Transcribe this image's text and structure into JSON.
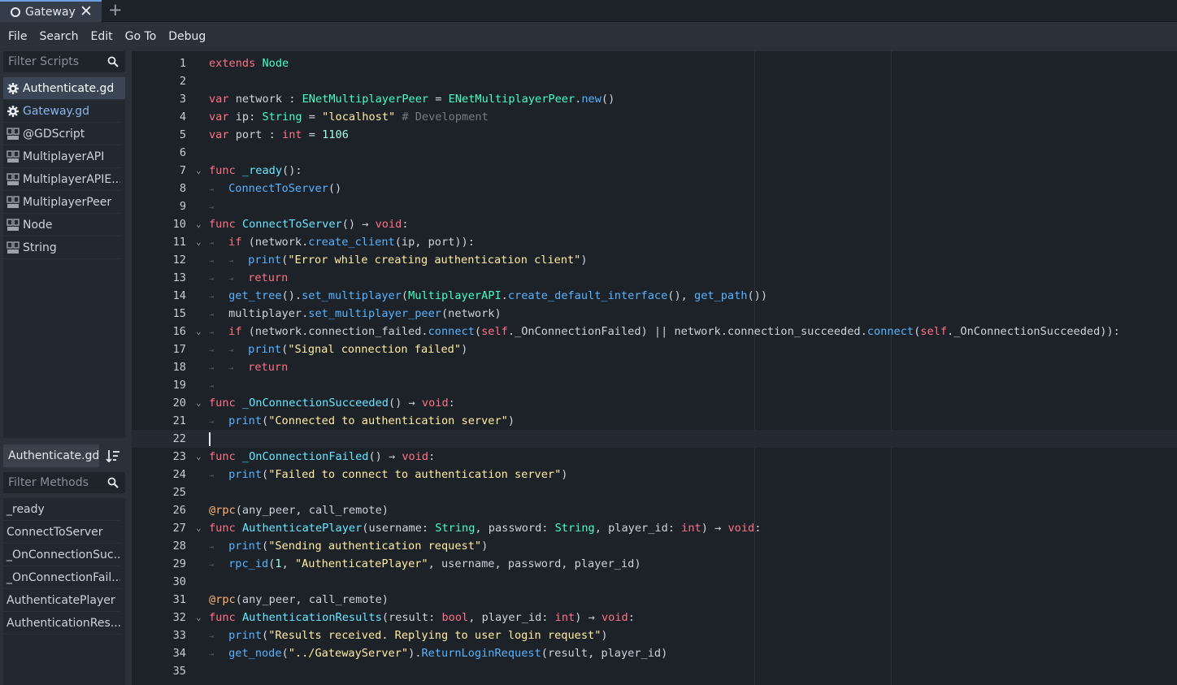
{
  "tab": {
    "title": "Gateway",
    "close_glyph": "✕",
    "new_glyph": "+"
  },
  "menu": [
    "File",
    "Search",
    "Edit",
    "Go To",
    "Debug"
  ],
  "script_filter": {
    "placeholder": "Filter Scripts"
  },
  "scripts": [
    {
      "label": "Authenticate.gd",
      "icon": "gear-icon",
      "state": "selected"
    },
    {
      "label": "Gateway.gd",
      "icon": "gear-icon",
      "state": "open"
    },
    {
      "label": "@GDScript",
      "icon": "doc-icon",
      "state": ""
    },
    {
      "label": "MultiplayerAPI",
      "icon": "doc-icon",
      "state": ""
    },
    {
      "label": "MultiplayerAPIE...",
      "icon": "doc-icon",
      "state": ""
    },
    {
      "label": "MultiplayerPeer",
      "icon": "doc-icon",
      "state": ""
    },
    {
      "label": "Node",
      "icon": "doc-icon",
      "state": ""
    },
    {
      "label": "String",
      "icon": "doc-icon",
      "state": ""
    }
  ],
  "current_file": "Authenticate.gd",
  "method_filter": {
    "placeholder": "Filter Methods"
  },
  "methods": [
    "_ready",
    "ConnectToServer",
    "_OnConnectionSuc...",
    "_OnConnectionFail...",
    "AuthenticatePlayer",
    "AuthenticationRes..."
  ],
  "colors": {
    "keyword": "#ff7085",
    "type": "#42ffc2",
    "function": "#57b3ff",
    "string": "#ffeda1",
    "number": "#a1ffe0",
    "comment": "#767b84",
    "annotation": "#ffb373",
    "selection": "#3a4656",
    "open_script": "#8bb4ec"
  },
  "editor": {
    "current_line": 22,
    "lines": [
      {
        "n": "1",
        "fold": false,
        "tokens": [
          [
            "kw",
            "extends"
          ],
          [
            "",
            "␠"
          ],
          [
            "ty",
            "Node"
          ]
        ]
      },
      {
        "n": "2",
        "fold": false,
        "tokens": []
      },
      {
        "n": "3",
        "fold": false,
        "tokens": [
          [
            "kw",
            "var"
          ],
          [
            "",
            "␠network␠:␠"
          ],
          [
            "ty",
            "ENetMultiplayerPeer"
          ],
          [
            "",
            "␠=␠"
          ],
          [
            "ty",
            "ENetMultiplayerPeer"
          ],
          [
            "",
            "."
          ],
          [
            "fn",
            "new"
          ],
          [
            "",
            "()"
          ]
        ]
      },
      {
        "n": "4",
        "fold": false,
        "tokens": [
          [
            "kw",
            "var"
          ],
          [
            "",
            "␠ip:␠"
          ],
          [
            "ty",
            "String"
          ],
          [
            "",
            "␠=␠"
          ],
          [
            "st",
            "\"localhost\""
          ],
          [
            "",
            "␠"
          ],
          [
            "cm",
            "#␠Development"
          ]
        ]
      },
      {
        "n": "5",
        "fold": false,
        "tokens": [
          [
            "kw",
            "var"
          ],
          [
            "",
            "␠port␠:␠"
          ],
          [
            "kw",
            "int"
          ],
          [
            "",
            "␠=␠"
          ],
          [
            "nm",
            "1106"
          ]
        ]
      },
      {
        "n": "6",
        "fold": false,
        "tokens": []
      },
      {
        "n": "7",
        "fold": true,
        "tokens": [
          [
            "kw",
            "func"
          ],
          [
            "",
            "␠"
          ],
          [
            "fd",
            "_ready"
          ],
          [
            "",
            "():"
          ]
        ]
      },
      {
        "n": "8",
        "fold": false,
        "tokens": [
          [
            "tab",
            "⇥"
          ],
          [
            "fn",
            "ConnectToServer"
          ],
          [
            "",
            "()"
          ]
        ]
      },
      {
        "n": "9",
        "fold": false,
        "tokens": [
          [
            "tab",
            "⇥"
          ]
        ]
      },
      {
        "n": "10",
        "fold": true,
        "tokens": [
          [
            "kw",
            "func"
          ],
          [
            "",
            "␠"
          ],
          [
            "fd",
            "ConnectToServer"
          ],
          [
            "",
            "()␠→␠"
          ],
          [
            "kw",
            "void"
          ],
          [
            "",
            ":"
          ]
        ]
      },
      {
        "n": "11",
        "fold": true,
        "tokens": [
          [
            "tab",
            "⇥"
          ],
          [
            "kw",
            "if"
          ],
          [
            "",
            "␠(network."
          ],
          [
            "fn",
            "create_client"
          ],
          [
            "",
            "(ip,␠port)):"
          ]
        ]
      },
      {
        "n": "12",
        "fold": false,
        "tokens": [
          [
            "tab",
            "⇥"
          ],
          [
            "tab",
            "⇥"
          ],
          [
            "fn",
            "print"
          ],
          [
            "",
            "("
          ],
          [
            "st",
            "\"Error␠while␠creating␠authentication␠client\""
          ],
          [
            "",
            ")"
          ]
        ]
      },
      {
        "n": "13",
        "fold": false,
        "tokens": [
          [
            "tab",
            "⇥"
          ],
          [
            "tab",
            "⇥"
          ],
          [
            "kw",
            "return"
          ]
        ]
      },
      {
        "n": "14",
        "fold": false,
        "tokens": [
          [
            "tab",
            "⇥"
          ],
          [
            "fn",
            "get_tree"
          ],
          [
            "",
            "()."
          ],
          [
            "fn",
            "set_multiplayer"
          ],
          [
            "",
            "("
          ],
          [
            "ty",
            "MultiplayerAPI"
          ],
          [
            "",
            "."
          ],
          [
            "fn",
            "create_default_interface"
          ],
          [
            "",
            "(),␠"
          ],
          [
            "fn",
            "get_path"
          ],
          [
            "",
            "())"
          ]
        ]
      },
      {
        "n": "15",
        "fold": false,
        "tokens": [
          [
            "tab",
            "⇥"
          ],
          [
            "",
            "multiplayer."
          ],
          [
            "fn",
            "set_multiplayer_peer"
          ],
          [
            "",
            "(network)"
          ]
        ]
      },
      {
        "n": "16",
        "fold": true,
        "tokens": [
          [
            "tab",
            "⇥"
          ],
          [
            "kw",
            "if"
          ],
          [
            "",
            "␠(network.connection_failed."
          ],
          [
            "fn",
            "connect"
          ],
          [
            "",
            "("
          ],
          [
            "kw",
            "self"
          ],
          [
            "",
            "._OnConnectionFailed)␠||␠network.connection_succeeded."
          ],
          [
            "fn",
            "connect"
          ],
          [
            "",
            "("
          ],
          [
            "kw",
            "self"
          ],
          [
            "",
            "._OnConnectionSucceeded)):"
          ]
        ]
      },
      {
        "n": "17",
        "fold": false,
        "tokens": [
          [
            "tab",
            "⇥"
          ],
          [
            "tab",
            "⇥"
          ],
          [
            "fn",
            "print"
          ],
          [
            "",
            "("
          ],
          [
            "st",
            "\"Signal␠connection␠failed\""
          ],
          [
            "",
            ")"
          ]
        ]
      },
      {
        "n": "18",
        "fold": false,
        "tokens": [
          [
            "tab",
            "⇥"
          ],
          [
            "tab",
            "⇥"
          ],
          [
            "kw",
            "return"
          ]
        ]
      },
      {
        "n": "19",
        "fold": false,
        "tokens": [
          [
            "tab",
            "⇥"
          ]
        ]
      },
      {
        "n": "20",
        "fold": true,
        "tokens": [
          [
            "kw",
            "func"
          ],
          [
            "",
            "␠"
          ],
          [
            "fd",
            "_OnConnectionSucceeded"
          ],
          [
            "",
            "()␠→␠"
          ],
          [
            "kw",
            "void"
          ],
          [
            "",
            ":"
          ]
        ]
      },
      {
        "n": "21",
        "fold": false,
        "tokens": [
          [
            "tab",
            "⇥"
          ],
          [
            "fn",
            "print"
          ],
          [
            "",
            "("
          ],
          [
            "st",
            "\"Connected␠to␠authentication␠server\""
          ],
          [
            "",
            ")"
          ]
        ]
      },
      {
        "n": "22",
        "fold": false,
        "tokens": []
      },
      {
        "n": "23",
        "fold": true,
        "tokens": [
          [
            "kw",
            "func"
          ],
          [
            "",
            "␠"
          ],
          [
            "fd",
            "_OnConnectionFailed"
          ],
          [
            "",
            "()␠→␠"
          ],
          [
            "kw",
            "void"
          ],
          [
            "",
            ":"
          ]
        ]
      },
      {
        "n": "24",
        "fold": false,
        "tokens": [
          [
            "tab",
            "⇥"
          ],
          [
            "fn",
            "print"
          ],
          [
            "",
            "("
          ],
          [
            "st",
            "\"Failed␠to␠connect␠to␠authentication␠server\""
          ],
          [
            "",
            ")"
          ]
        ]
      },
      {
        "n": "25",
        "fold": false,
        "tokens": []
      },
      {
        "n": "26",
        "fold": false,
        "tokens": [
          [
            "an",
            "@rpc"
          ],
          [
            "",
            "(any_peer,␠call_remote)"
          ]
        ]
      },
      {
        "n": "27",
        "fold": true,
        "tokens": [
          [
            "kw",
            "func"
          ],
          [
            "",
            "␠"
          ],
          [
            "fd",
            "AuthenticatePlayer"
          ],
          [
            "",
            "(username:␠"
          ],
          [
            "ty",
            "String"
          ],
          [
            "",
            ",␠password:␠"
          ],
          [
            "ty",
            "String"
          ],
          [
            "",
            ",␠player_id:␠"
          ],
          [
            "kw",
            "int"
          ],
          [
            "",
            ")␠→␠"
          ],
          [
            "kw",
            "void"
          ],
          [
            "",
            ":"
          ]
        ]
      },
      {
        "n": "28",
        "fold": false,
        "tokens": [
          [
            "tab",
            "⇥"
          ],
          [
            "fn",
            "print"
          ],
          [
            "",
            "("
          ],
          [
            "st",
            "\"Sending␠authentication␠request\""
          ],
          [
            "",
            ")"
          ]
        ]
      },
      {
        "n": "29",
        "fold": false,
        "tokens": [
          [
            "tab",
            "⇥"
          ],
          [
            "fn",
            "rpc_id"
          ],
          [
            "",
            "("
          ],
          [
            "nm",
            "1"
          ],
          [
            "",
            ",␠"
          ],
          [
            "st",
            "\"AuthenticatePlayer\""
          ],
          [
            "",
            ",␠username,␠password,␠player_id)"
          ]
        ]
      },
      {
        "n": "30",
        "fold": false,
        "tokens": []
      },
      {
        "n": "31",
        "fold": false,
        "tokens": [
          [
            "an",
            "@rpc"
          ],
          [
            "",
            "(any_peer,␠call_remote)"
          ]
        ]
      },
      {
        "n": "32",
        "fold": true,
        "tokens": [
          [
            "kw",
            "func"
          ],
          [
            "",
            "␠"
          ],
          [
            "fd",
            "AuthenticationResults"
          ],
          [
            "",
            "(result:␠"
          ],
          [
            "kw",
            "bool"
          ],
          [
            "",
            ",␠player_id:␠"
          ],
          [
            "kw",
            "int"
          ],
          [
            "",
            ")␠→␠"
          ],
          [
            "kw",
            "void"
          ],
          [
            "",
            ":"
          ]
        ]
      },
      {
        "n": "33",
        "fold": false,
        "tokens": [
          [
            "tab",
            "⇥"
          ],
          [
            "fn",
            "print"
          ],
          [
            "",
            "("
          ],
          [
            "st",
            "\"Results␠received.␠Replying␠to␠user␠login␠request\""
          ],
          [
            "",
            ")"
          ]
        ]
      },
      {
        "n": "34",
        "fold": false,
        "tokens": [
          [
            "tab",
            "⇥"
          ],
          [
            "fn",
            "get_node"
          ],
          [
            "",
            "("
          ],
          [
            "st",
            "\"../GatewayServer\""
          ],
          [
            "",
            ")."
          ],
          [
            "fn",
            "ReturnLoginRequest"
          ],
          [
            "",
            "(result,␠player_id)"
          ]
        ]
      },
      {
        "n": "35",
        "fold": false,
        "tokens": []
      }
    ]
  }
}
